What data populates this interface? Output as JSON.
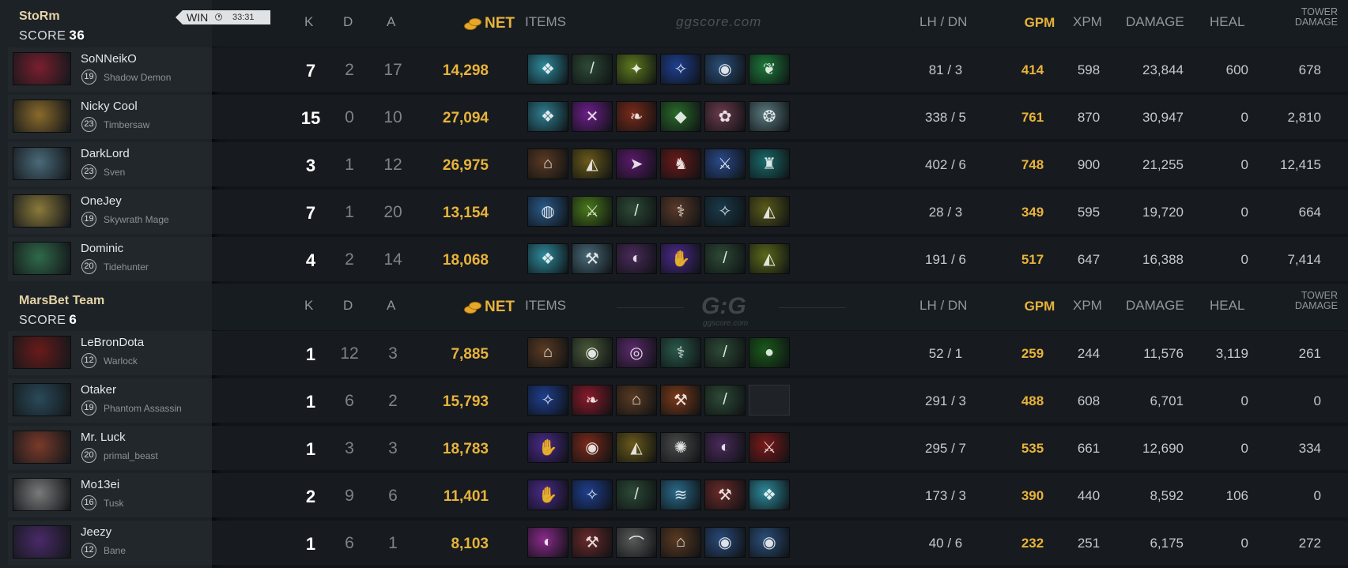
{
  "headers": {
    "k": "K",
    "d": "D",
    "a": "A",
    "net": "NET",
    "items": "ITEMS",
    "lh_dn": "LH  /  DN",
    "gpm": "GPM",
    "xpm": "XPM",
    "damage": "DAMAGE",
    "heal": "HEAL",
    "tower": "TOWER DAMAGE",
    "tower_line1": "TOWER",
    "tower_line2": "DAMAGE"
  },
  "watermark": "ggscore.com",
  "logo": {
    "text": "G:G",
    "sub": "ggscore.com"
  },
  "teams": [
    {
      "name": "StoRm",
      "score_label": "SCORE",
      "score": "36",
      "result": "WIN",
      "duration": "33:31",
      "players": [
        {
          "name": "SoNNeikO",
          "level": "19",
          "hero": "Shadow Demon",
          "portrait_color": "#7a1f2e",
          "k": "7",
          "d": "2",
          "a": "17",
          "net": "14,298",
          "lh_dn": "81  /  3",
          "gpm": "414",
          "xpm": "598",
          "damage": "23,844",
          "heal": "600",
          "tower": "678",
          "items": [
            {
              "color": "#2e8a9c",
              "icon": "❖"
            },
            {
              "color": "#2d4a36",
              "icon": "/"
            },
            {
              "color": "#5f7a1e",
              "icon": "✦"
            },
            {
              "color": "#1f3f8f",
              "icon": "✧"
            },
            {
              "color": "#2b4f7a",
              "icon": "◉"
            },
            {
              "color": "#1e7a3a",
              "icon": "❦"
            }
          ]
        },
        {
          "name": "Nicky Cool",
          "level": "23",
          "hero": "Timbersaw",
          "portrait_color": "#8a6a2a",
          "k": "15",
          "d": "0",
          "a": "10",
          "net": "27,094",
          "lh_dn": "338  /  5",
          "gpm": "761",
          "xpm": "870",
          "damage": "30,947",
          "heal": "0",
          "tower": "2,810",
          "items": [
            {
              "color": "#2e7e90",
              "icon": "❖"
            },
            {
              "color": "#6d1f8a",
              "icon": "✕"
            },
            {
              "color": "#7a2a1a",
              "icon": "❧"
            },
            {
              "color": "#2a6a2a",
              "icon": "◆"
            },
            {
              "color": "#6a3a4a",
              "icon": "✿"
            },
            {
              "color": "#5a7a80",
              "icon": "❂"
            }
          ]
        },
        {
          "name": "DarkLord",
          "level": "23",
          "hero": "Sven",
          "portrait_color": "#4a6a7a",
          "k": "3",
          "d": "1",
          "a": "12",
          "net": "26,975",
          "lh_dn": "402  /  6",
          "gpm": "748",
          "xpm": "900",
          "damage": "21,255",
          "heal": "0",
          "tower": "12,415",
          "items": [
            {
              "color": "#5a3a22",
              "icon": "⌂"
            },
            {
              "color": "#6a5a1a",
              "icon": "◭"
            },
            {
              "color": "#5a1a6a",
              "icon": "➤"
            },
            {
              "color": "#6a1a1a",
              "icon": "♞"
            },
            {
              "color": "#2a4a8a",
              "icon": "⚔"
            },
            {
              "color": "#1a6a6a",
              "icon": "♜"
            }
          ]
        },
        {
          "name": "OneJey",
          "level": "19",
          "hero": "Skywrath Mage",
          "portrait_color": "#8a7a3a",
          "k": "7",
          "d": "1",
          "a": "20",
          "net": "13,154",
          "lh_dn": "28  /  3",
          "gpm": "349",
          "xpm": "595",
          "damage": "19,720",
          "heal": "0",
          "tower": "664",
          "items": [
            {
              "color": "#2a5a8a",
              "icon": "◍"
            },
            {
              "color": "#4a7a1a",
              "icon": "⚔"
            },
            {
              "color": "#2d4a36",
              "icon": "/"
            },
            {
              "color": "#5a3a2a",
              "icon": "⚕"
            },
            {
              "color": "#1a3a4a",
              "icon": "✧"
            },
            {
              "color": "#5a5a1a",
              "icon": "◭"
            }
          ]
        },
        {
          "name": "Dominic",
          "level": "20",
          "hero": "Tidehunter",
          "portrait_color": "#2f6a4a",
          "k": "4",
          "d": "2",
          "a": "14",
          "net": "18,068",
          "lh_dn": "191  /  6",
          "gpm": "517",
          "xpm": "647",
          "damage": "16,388",
          "heal": "0",
          "tower": "7,414",
          "items": [
            {
              "color": "#2e8a9c",
              "icon": "❖"
            },
            {
              "color": "#4a6a7a",
              "icon": "⚒"
            },
            {
              "color": "#4a2a5a",
              "icon": "◐"
            },
            {
              "color": "#4a2a8a",
              "icon": "✋"
            },
            {
              "color": "#2d4a36",
              "icon": "/"
            },
            {
              "color": "#5a6a1a",
              "icon": "◭"
            }
          ]
        }
      ]
    },
    {
      "name": "MarsBet Team",
      "score_label": "SCORE",
      "score": "6",
      "players": [
        {
          "name": "LeBronDota",
          "level": "12",
          "hero": "Warlock",
          "portrait_color": "#6a1a1a",
          "k": "1",
          "d": "12",
          "a": "3",
          "net": "7,885",
          "lh_dn": "52  /  1",
          "gpm": "259",
          "xpm": "244",
          "damage": "11,576",
          "heal": "3,119",
          "tower": "261",
          "items": [
            {
              "color": "#5a3a22",
              "icon": "⌂"
            },
            {
              "color": "#4a5a3a",
              "icon": "◉"
            },
            {
              "color": "#5a2a6a",
              "icon": "◎"
            },
            {
              "color": "#2a5a4a",
              "icon": "⚕"
            },
            {
              "color": "#2d4a36",
              "icon": "/"
            },
            {
              "color": "#1a5a1a",
              "icon": "●"
            }
          ]
        },
        {
          "name": "Otaker",
          "level": "19",
          "hero": "Phantom Assassin",
          "portrait_color": "#2a4a5a",
          "k": "1",
          "d": "6",
          "a": "2",
          "net": "15,793",
          "lh_dn": "291  /  3",
          "gpm": "488",
          "xpm": "608",
          "damage": "6,701",
          "heal": "0",
          "tower": "0",
          "items": [
            {
              "color": "#1f3f8f",
              "icon": "✧"
            },
            {
              "color": "#8a1a2a",
              "icon": "❧"
            },
            {
              "color": "#5a3a22",
              "icon": "⌂"
            },
            {
              "color": "#7a3a1a",
              "icon": "⚒"
            },
            {
              "color": "#2d4a36",
              "icon": "/"
            },
            {
              "color": "",
              "icon": ""
            }
          ]
        },
        {
          "name": "Mr. Luck",
          "level": "20",
          "hero": "primal_beast",
          "portrait_color": "#7a3a2a",
          "k": "1",
          "d": "3",
          "a": "3",
          "net": "18,783",
          "lh_dn": "295  /  7",
          "gpm": "535",
          "xpm": "661",
          "damage": "12,690",
          "heal": "0",
          "tower": "334",
          "items": [
            {
              "color": "#4a2a8a",
              "icon": "✋"
            },
            {
              "color": "#7a2a1a",
              "icon": "◉"
            },
            {
              "color": "#6a5a1a",
              "icon": "◭"
            },
            {
              "color": "#4a4a4a",
              "icon": "✺"
            },
            {
              "color": "#4a2a5a",
              "icon": "◐"
            },
            {
              "color": "#7a1a1a",
              "icon": "⚔"
            }
          ]
        },
        {
          "name": "Mo13ei",
          "level": "16",
          "hero": "Tusk",
          "portrait_color": "#7a7a7a",
          "k": "2",
          "d": "9",
          "a": "6",
          "net": "11,401",
          "lh_dn": "173  /  3",
          "gpm": "390",
          "xpm": "440",
          "damage": "8,592",
          "heal": "106",
          "tower": "0",
          "items": [
            {
              "color": "#4a2a8a",
              "icon": "✋"
            },
            {
              "color": "#1f3f8f",
              "icon": "✧"
            },
            {
              "color": "#2d4a36",
              "icon": "/"
            },
            {
              "color": "#2a6a8a",
              "icon": "≋"
            },
            {
              "color": "#6a2a2a",
              "icon": "⚒"
            },
            {
              "color": "#2e8a9c",
              "icon": "❖"
            }
          ]
        },
        {
          "name": "Jeezy",
          "level": "12",
          "hero": "Bane",
          "portrait_color": "#4a2a6a",
          "k": "1",
          "d": "6",
          "a": "1",
          "net": "8,103",
          "lh_dn": "40  /  6",
          "gpm": "232",
          "xpm": "251",
          "damage": "6,175",
          "heal": "0",
          "tower": "272",
          "items": [
            {
              "color": "#8a2a8a",
              "icon": "◐"
            },
            {
              "color": "#6a2a2a",
              "icon": "⚒"
            },
            {
              "color": "#5a5a5a",
              "icon": "⌒"
            },
            {
              "color": "#5a3a22",
              "icon": "⌂"
            },
            {
              "color": "#2a4a7a",
              "icon": "◉"
            },
            {
              "color": "#2b4f7a",
              "icon": "◉"
            }
          ]
        }
      ]
    }
  ]
}
